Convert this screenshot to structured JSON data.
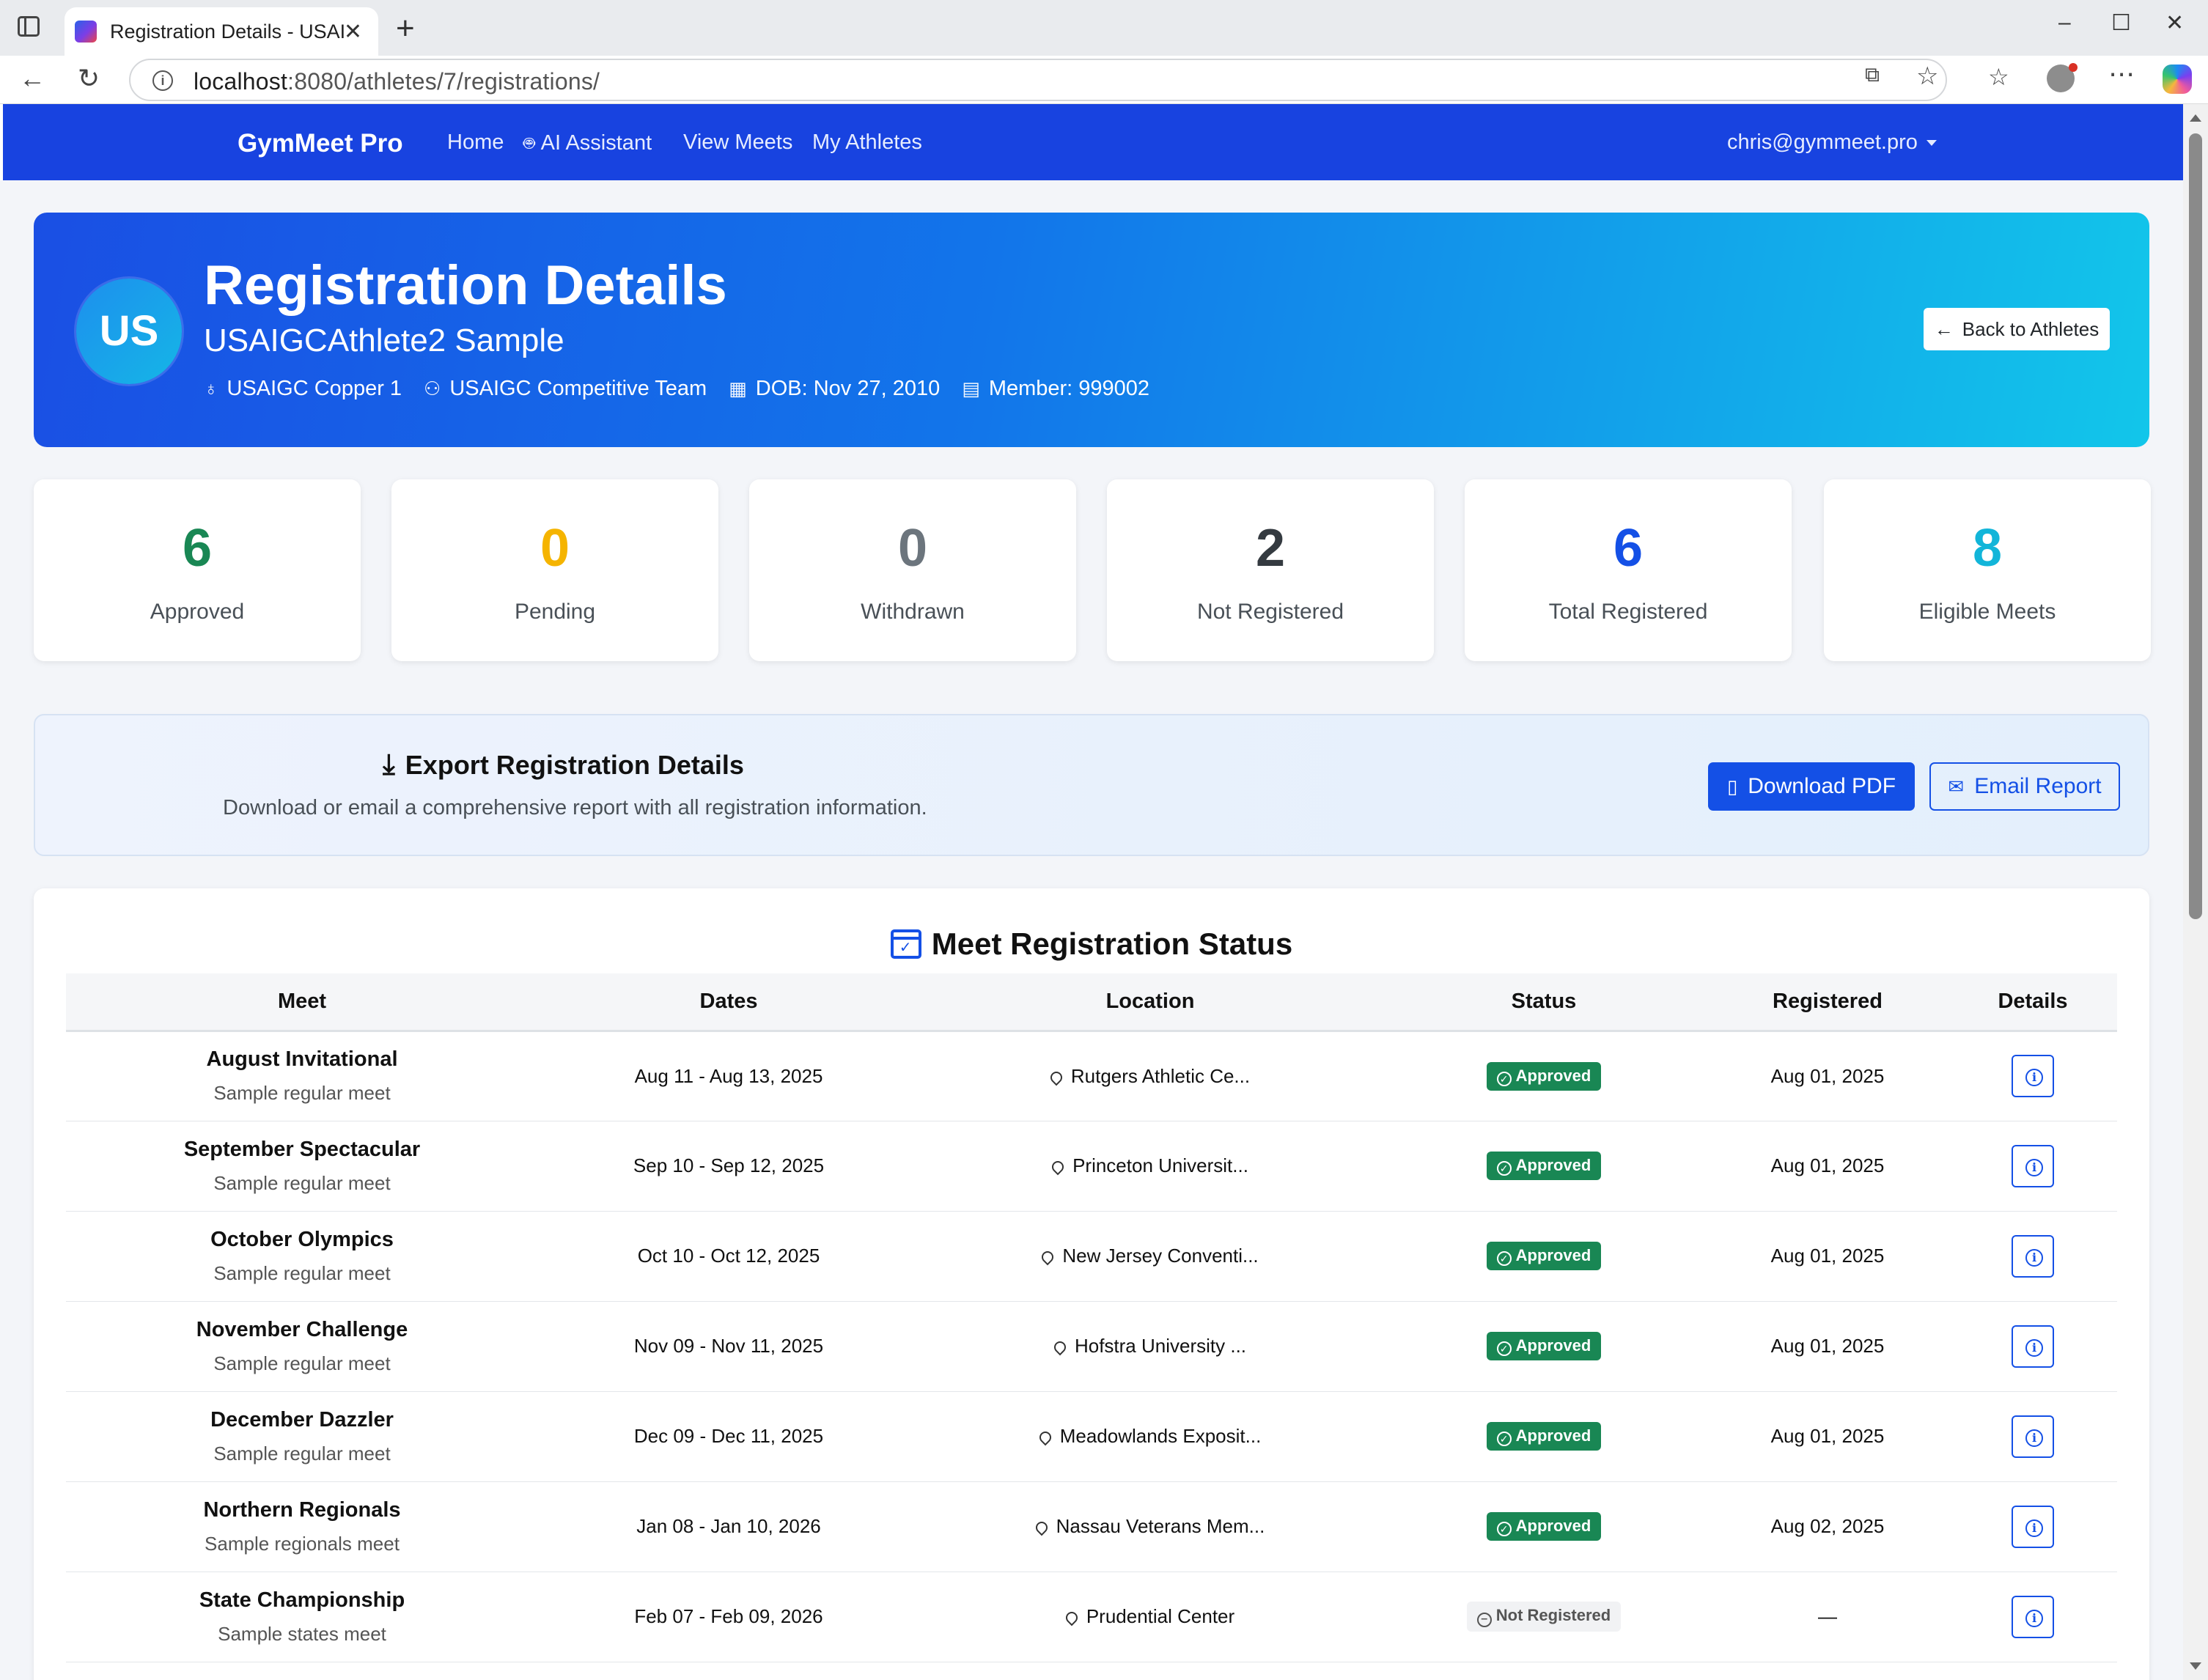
{
  "browser": {
    "tab_title": "Registration Details - USAIGC",
    "url_host": "localhost",
    "url_path": ":8080/athletes/7/registrations/"
  },
  "nav": {
    "brand": "GymMeet Pro",
    "links": [
      "Home",
      "AI Assistant",
      "View Meets",
      "My Athletes"
    ],
    "user": "chris@gymmeet.pro"
  },
  "hero": {
    "initials": "US",
    "title": "Registration Details",
    "athlete_name": "USAIGCAthlete2 Sample",
    "level": "USAIGC Copper 1",
    "team": "USAIGC Competitive Team",
    "dob": "DOB: Nov 27, 2010",
    "member": "Member: 999002",
    "back_label": "Back to Athletes"
  },
  "stats": [
    {
      "value": "6",
      "label": "Approved",
      "color": "#198754"
    },
    {
      "value": "0",
      "label": "Pending",
      "color": "#f5b400"
    },
    {
      "value": "0",
      "label": "Withdrawn",
      "color": "#6c757d"
    },
    {
      "value": "2",
      "label": "Not Registered",
      "color": "#343a40"
    },
    {
      "value": "6",
      "label": "Total Registered",
      "color": "#1450e6"
    },
    {
      "value": "8",
      "label": "Eligible Meets",
      "color": "#12b5d9"
    }
  ],
  "export": {
    "title": "Export Registration Details",
    "description": "Download or email a comprehensive report with all registration information.",
    "pdf_label": "Download PDF",
    "email_label": "Email Report"
  },
  "table": {
    "title": "Meet Registration Status",
    "headers": [
      "Meet",
      "Dates",
      "Location",
      "Status",
      "Registered",
      "Details"
    ],
    "rows": [
      {
        "name": "August Invitational",
        "sub": "Sample regular meet",
        "dates": "Aug 11 - Aug 13, 2025",
        "location": "Rutgers Athletic Ce...",
        "status": "Approved",
        "registered": "Aug 01, 2025"
      },
      {
        "name": "September Spectacular",
        "sub": "Sample regular meet",
        "dates": "Sep 10 - Sep 12, 2025",
        "location": "Princeton Universit...",
        "status": "Approved",
        "registered": "Aug 01, 2025"
      },
      {
        "name": "October Olympics",
        "sub": "Sample regular meet",
        "dates": "Oct 10 - Oct 12, 2025",
        "location": "New Jersey Conventi...",
        "status": "Approved",
        "registered": "Aug 01, 2025"
      },
      {
        "name": "November Challenge",
        "sub": "Sample regular meet",
        "dates": "Nov 09 - Nov 11, 2025",
        "location": "Hofstra University ...",
        "status": "Approved",
        "registered": "Aug 01, 2025"
      },
      {
        "name": "December Dazzler",
        "sub": "Sample regular meet",
        "dates": "Dec 09 - Dec 11, 2025",
        "location": "Meadowlands Exposit...",
        "status": "Approved",
        "registered": "Aug 01, 2025"
      },
      {
        "name": "Northern Regionals",
        "sub": "Sample regionals meet",
        "dates": "Jan 08 - Jan 10, 2026",
        "location": "Nassau Veterans Mem...",
        "status": "Approved",
        "registered": "Aug 02, 2025"
      },
      {
        "name": "State Championship",
        "sub": "Sample states meet",
        "dates": "Feb 07 - Feb 09, 2026",
        "location": "Prudential Center",
        "status": "Not Registered",
        "registered": "—"
      }
    ]
  }
}
